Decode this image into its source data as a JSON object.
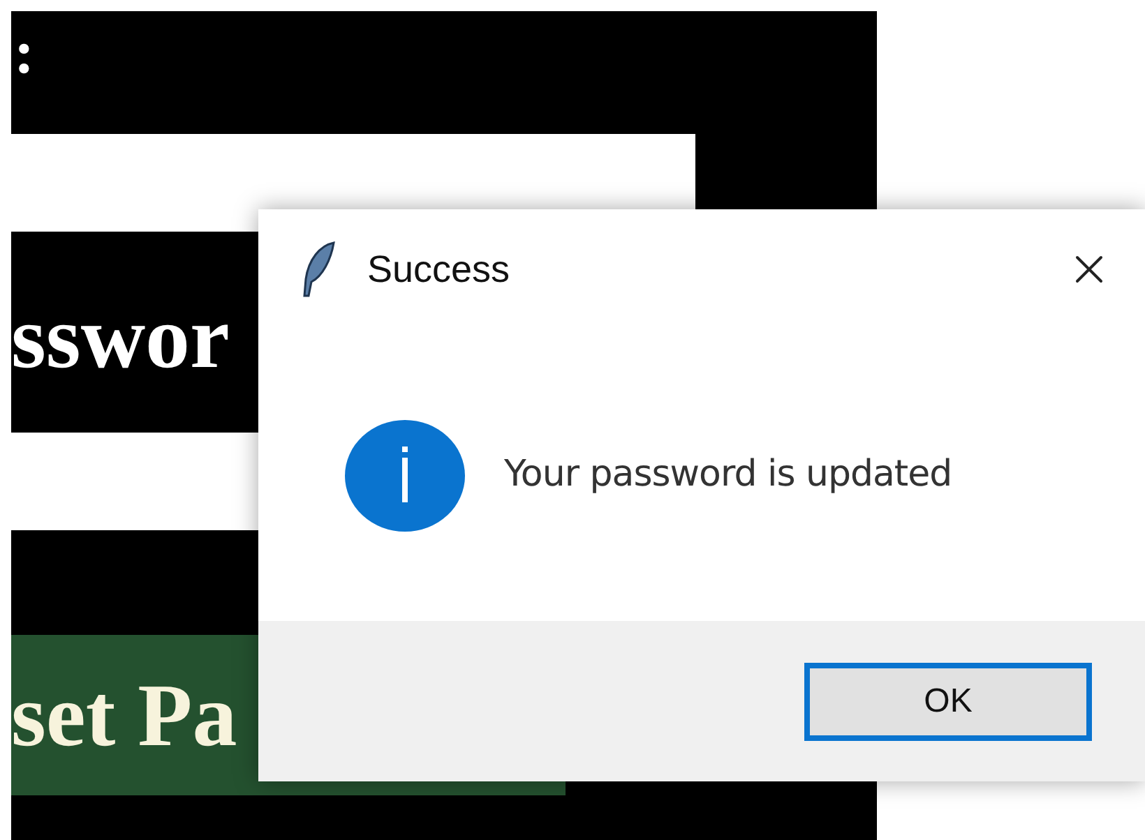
{
  "background_window": {
    "label_1": ":",
    "label_2": "sswor",
    "button": "set Pa"
  },
  "dialog": {
    "title": "Success",
    "message": "Your password is updated",
    "buttons": [
      {
        "label": "OK",
        "focused": true
      }
    ]
  }
}
